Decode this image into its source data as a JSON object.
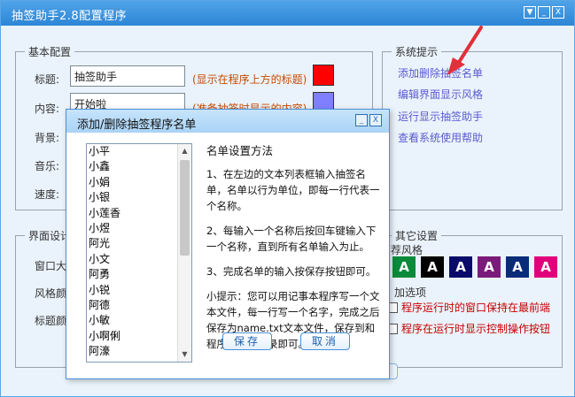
{
  "main": {
    "title": "抽签助手2.8配置程序",
    "win_buttons": [
      "▼",
      "_",
      "X"
    ]
  },
  "basic": {
    "group_title": "基本配置",
    "title_label": "标题:",
    "title_value": "抽签助手",
    "title_hint": "(显示在程序上方的标题)",
    "title_color": "#ff0000",
    "content_label": "内容:",
    "content_value": "开始啦",
    "content_hint": "(准备抽签时显示的内容)",
    "content_color": "#8080ff",
    "bg_label": "背景:",
    "music_label": "音乐:",
    "speed_label": "速度:"
  },
  "system": {
    "group_title": "系统提示",
    "links": [
      "添加删除抽签名单",
      "编辑界面显示风格",
      "运行显示抽签助手",
      "查看系统使用帮助"
    ]
  },
  "ui_settings": {
    "group_title": "界面设计",
    "labels": [
      "窗口大",
      "风格颜",
      "标题颜"
    ]
  },
  "other": {
    "group_title": "其它设置",
    "style_label": "荐风格",
    "style_boxes": [
      {
        "text": "A",
        "color": "#0a8a3a"
      },
      {
        "text": "A",
        "color": "#000000"
      },
      {
        "text": "A",
        "color": "#0a0a6a"
      },
      {
        "text": "A",
        "color": "#7a1a7a"
      },
      {
        "text": "A",
        "color": "#0a2a7a"
      },
      {
        "text": "A",
        "color": "#e0007a"
      }
    ],
    "extra_label": "加选项",
    "checks": [
      "程序运行时的窗口保持在最前端",
      "程序在运行时显示控制操作按钮"
    ]
  },
  "dialog": {
    "title": "添加/删除抽签程序名单",
    "buttons": [
      "_",
      "X"
    ],
    "names": [
      "小平",
      "小鑫",
      "小娟",
      "小银",
      "小莲香",
      "小煜",
      "阿光",
      "小文",
      "阿勇",
      "小锐",
      "阿德",
      "小敏",
      "小啊俐",
      "阿濠"
    ],
    "instructions": {
      "title": "名单设置方法",
      "p1": "1、在左边的文本列表框输入抽签名单，名单以行为单位，即每一行代表一个名称。",
      "p2": "2、每输入一个名称后按回车键输入下一个名称，直到所有名单输入为止。",
      "p3": "3、完成名单的输入按保存按钮即可。",
      "tip": "小提示：您可以用记事本程序写一个文本文件，每一行写一个名字，完成之后保存为name.txt文本文件，保存到和程序相同的目录即可。"
    },
    "save_label": "保存",
    "cancel_label": "取消"
  },
  "colors": {
    "accent": "#2d86d6",
    "arrow": "#e0303a"
  }
}
